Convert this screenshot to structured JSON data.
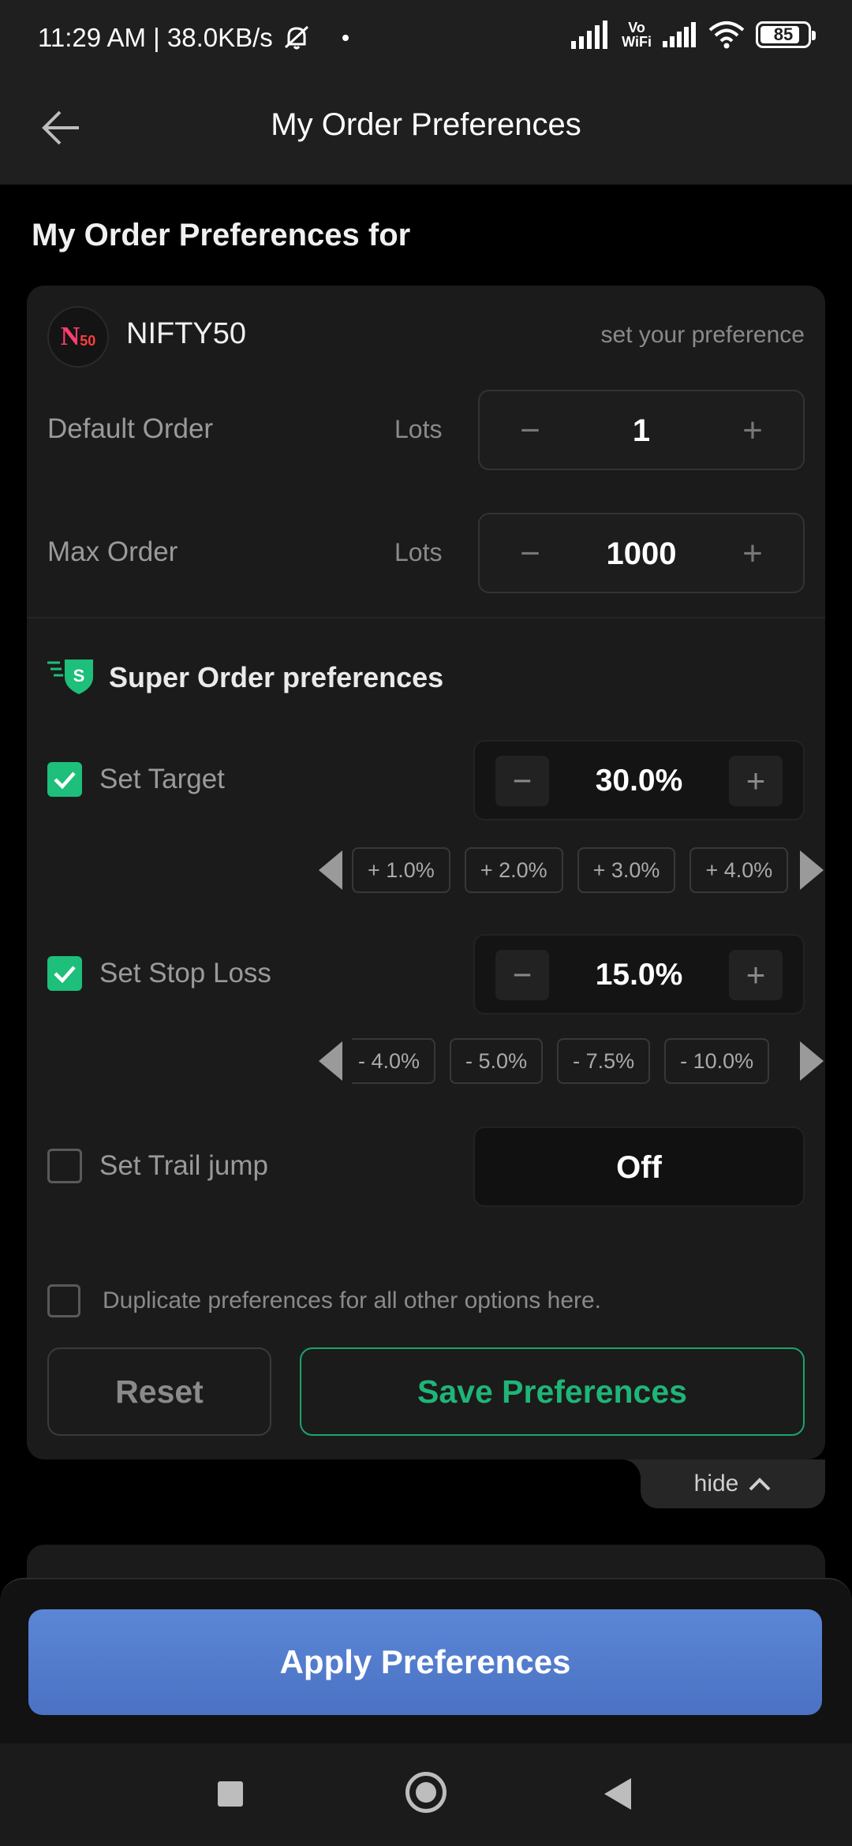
{
  "status_bar": {
    "time_speed": "11:29 AM | 38.0KB/s",
    "vowifi_top": "Vo",
    "vowifi_bottom": "WiFi",
    "battery": "85",
    "battery_level": 0.85
  },
  "header": {
    "title": "My Order Preferences"
  },
  "section": {
    "title": "My Order Preferences for"
  },
  "instrument": {
    "logo_text_n": "N",
    "logo_text_50": "50",
    "name": "NIFTY50",
    "hint": "set your preference"
  },
  "default_order": {
    "label": "Default Order",
    "unit": "Lots",
    "minus": "−",
    "value": "1",
    "plus": "+"
  },
  "max_order": {
    "label": "Max Order",
    "unit": "Lots",
    "minus": "−",
    "value": "1000",
    "plus": "+"
  },
  "super_order": {
    "badge": "S",
    "label": "Super Order preferences"
  },
  "target": {
    "label": "Set Target",
    "checked": true,
    "minus": "−",
    "value": "30.0%",
    "plus": "+",
    "chips": [
      "+ 1.0%",
      "+ 2.0%",
      "+ 3.0%",
      "+ 4.0%"
    ]
  },
  "stop_loss": {
    "label": "Set Stop Loss",
    "checked": true,
    "minus": "−",
    "value": "15.0%",
    "plus": "+",
    "chips": [
      "- 4.0%",
      "- 5.0%",
      "- 7.5%",
      "- 10.0%"
    ]
  },
  "trail_jump": {
    "label": "Set Trail jump",
    "checked": false,
    "value": "Off"
  },
  "duplicate": {
    "label": "Duplicate preferences for all other options here.",
    "checked": false
  },
  "buttons": {
    "reset": "Reset",
    "save": "Save Preferences",
    "hide": "hide",
    "apply": "Apply Preferences"
  },
  "colors": {
    "accent_green": "#1dbf7a",
    "apply_blue": "#5b86d6",
    "background": "#000000",
    "card": "#1b1b1b"
  }
}
